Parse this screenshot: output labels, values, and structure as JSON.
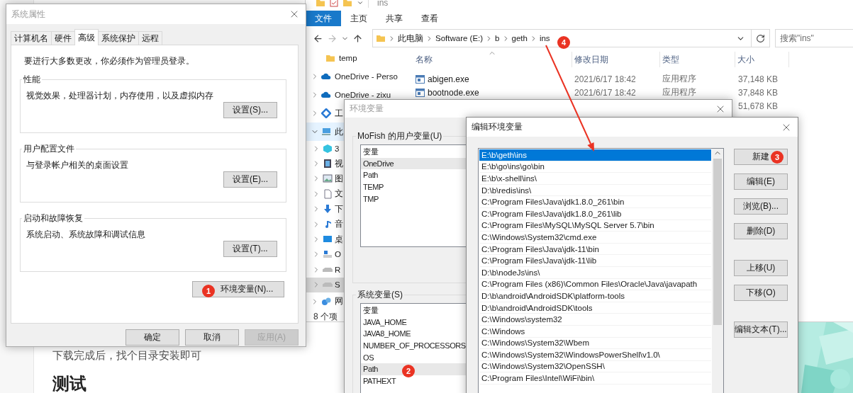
{
  "article": {
    "paragraph": "下载完成后，找个目录安装即可",
    "heading": "测试"
  },
  "explorer": {
    "title": "ins",
    "ribbon_tabs": [
      {
        "label": "文件",
        "selected": true
      },
      {
        "label": "主页",
        "selected": false
      },
      {
        "label": "共享",
        "selected": false
      },
      {
        "label": "查看",
        "selected": false
      }
    ],
    "breadcrumb": [
      "此电脑",
      "Software (E:)",
      "b",
      "geth",
      "ins"
    ],
    "search": {
      "placeholder": "搜索\"ins\""
    },
    "nav": [
      {
        "label": "temp",
        "kind": "leaf",
        "selected": false,
        "hovered": false
      },
      {
        "label": "OneDrive - Perso",
        "kind": "node",
        "expanded": false,
        "selected": false,
        "hovered": false
      },
      {
        "label": "OneDrive - zixu",
        "kind": "node",
        "expanded": false,
        "selected": false,
        "hovered": false
      },
      {
        "label": "工",
        "kind": "node",
        "expanded": false,
        "selected": false,
        "hovered": false
      },
      {
        "label": "此",
        "kind": "node",
        "expanded": true,
        "selected": false,
        "hovered": true,
        "children": [
          {
            "label": "3",
            "kind": "node",
            "expanded": false,
            "selected": false,
            "hovered": false
          },
          {
            "label": "视",
            "kind": "node",
            "expanded": false,
            "selected": false,
            "hovered": false
          },
          {
            "label": "图",
            "kind": "node",
            "expanded": false,
            "selected": false,
            "hovered": false
          },
          {
            "label": "文",
            "kind": "node",
            "expanded": false,
            "selected": false,
            "hovered": false
          },
          {
            "label": "下",
            "kind": "node",
            "expanded": false,
            "selected": false,
            "hovered": false
          },
          {
            "label": "音",
            "kind": "node",
            "expanded": false,
            "selected": false,
            "hovered": false
          },
          {
            "label": "桌",
            "kind": "node",
            "expanded": false,
            "selected": false,
            "hovered": false
          },
          {
            "label": "O",
            "kind": "node",
            "expanded": false,
            "selected": false,
            "hovered": false
          },
          {
            "label": "R",
            "kind": "node",
            "expanded": false,
            "selected": false,
            "hovered": false
          },
          {
            "label": "S",
            "kind": "node",
            "expanded": false,
            "selected": true,
            "hovered": false
          }
        ]
      },
      {
        "label": "网",
        "kind": "node",
        "expanded": false,
        "selected": false,
        "hovered": false
      }
    ],
    "status": "8 个项",
    "columns": [
      "名称",
      "修改日期",
      "类型",
      "大小"
    ],
    "rows": [
      {
        "name": "abigen.exe",
        "date": "2021/6/17 18:42",
        "type": "应用程序",
        "size": "37,148 KB"
      },
      {
        "name": "bootnode.exe",
        "date": "2021/6/17 18:42",
        "type": "应用程序",
        "size": "37,848 KB"
      },
      {
        "size": "51,678 KB"
      }
    ]
  },
  "system_properties": {
    "title": "系统属性",
    "tabs": [
      {
        "label": "计算机名",
        "selected": false
      },
      {
        "label": "硬件",
        "selected": false
      },
      {
        "label": "高级",
        "selected": true
      },
      {
        "label": "系统保护",
        "selected": false
      },
      {
        "label": "远程",
        "selected": false
      }
    ],
    "notice": "要进行大多数更改，你必须作为管理员登录。",
    "groups": [
      {
        "title": "性能",
        "text": "视觉效果，处理器计划，内存使用，以及虚拟内存",
        "button": "设置(S)..."
      },
      {
        "title": "用户配置文件",
        "text": "与登录帐户相关的桌面设置",
        "button": "设置(E)..."
      },
      {
        "title": "启动和故障恢复",
        "text": "系统启动、系统故障和调试信息",
        "button": "设置(T)..."
      }
    ],
    "env_button": "环境变量(N)...",
    "buttons": [
      {
        "label": "确定",
        "disabled": false
      },
      {
        "label": "取消",
        "disabled": false
      },
      {
        "label": "应用(A)",
        "disabled": true
      }
    ]
  },
  "environment_variables": {
    "title": "环境变量",
    "groups": [
      {
        "title": "MoFish 的用户变量(U)",
        "column": "变量",
        "rows": [
          {
            "name": "OneDrive",
            "selected": true
          },
          {
            "name": "Path",
            "selected": false
          },
          {
            "name": "TEMP",
            "selected": false
          },
          {
            "name": "TMP",
            "selected": false
          }
        ]
      },
      {
        "title": "系统变量(S)",
        "column": "变量",
        "rows": [
          {
            "name": "JAVA_HOME",
            "selected": false
          },
          {
            "name": "JAVA8_HOME",
            "selected": false
          },
          {
            "name": "NUMBER_OF_PROCESSORS",
            "selected": false
          },
          {
            "name": "OS",
            "selected": false
          },
          {
            "name": "Path",
            "selected": true
          },
          {
            "name": "PATHEXT",
            "selected": false
          }
        ]
      }
    ]
  },
  "edit_variable": {
    "title": "编辑环境变量",
    "entries": [
      {
        "value": "E:\\b\\geth\\ins",
        "selected": true
      },
      {
        "value": "E:\\b\\go\\ins\\go\\bin",
        "selected": false
      },
      {
        "value": "E:\\b\\x-shell\\ins\\",
        "selected": false
      },
      {
        "value": "D:\\b\\redis\\ins\\",
        "selected": false
      },
      {
        "value": "C:\\Program Files\\Java\\jdk1.8.0_261\\bin",
        "selected": false
      },
      {
        "value": "C:\\Program Files\\Java\\jdk1.8.0_261\\lib",
        "selected": false
      },
      {
        "value": "C:\\Program Files\\MySQL\\MySQL Server 5.7\\bin",
        "selected": false
      },
      {
        "value": "C:\\Windows\\System32\\cmd.exe",
        "selected": false
      },
      {
        "value": "C:\\Program Files\\Java\\jdk-11\\bin",
        "selected": false
      },
      {
        "value": "C:\\Program Files\\Java\\jdk-11\\lib",
        "selected": false
      },
      {
        "value": "D:\\b\\nodeJs\\ins\\",
        "selected": false
      },
      {
        "value": "C:\\Program Files (x86)\\Common Files\\Oracle\\Java\\javapath",
        "selected": false
      },
      {
        "value": "D:\\b\\android\\AndroidSDK\\platform-tools",
        "selected": false
      },
      {
        "value": "D:\\b\\android\\AndroidSDK\\tools",
        "selected": false
      },
      {
        "value": "C:\\Windows\\system32",
        "selected": false
      },
      {
        "value": "C:\\Windows",
        "selected": false
      },
      {
        "value": "C:\\Windows\\System32\\Wbem",
        "selected": false
      },
      {
        "value": "C:\\Windows\\System32\\WindowsPowerShell\\v1.0\\",
        "selected": false
      },
      {
        "value": "C:\\Windows\\System32\\OpenSSH\\",
        "selected": false
      },
      {
        "value": "C:\\Program Files\\Intel\\WiFi\\bin\\",
        "selected": false
      }
    ],
    "button_groups": [
      [
        "新建",
        "编辑(E)",
        "浏览(B)...",
        "删除(D)"
      ],
      [
        "上移(U)",
        "下移(O)"
      ],
      [
        "编辑文本(T)..."
      ]
    ]
  },
  "annotations": {
    "badges": [
      "1",
      "2",
      "3",
      "4"
    ]
  }
}
